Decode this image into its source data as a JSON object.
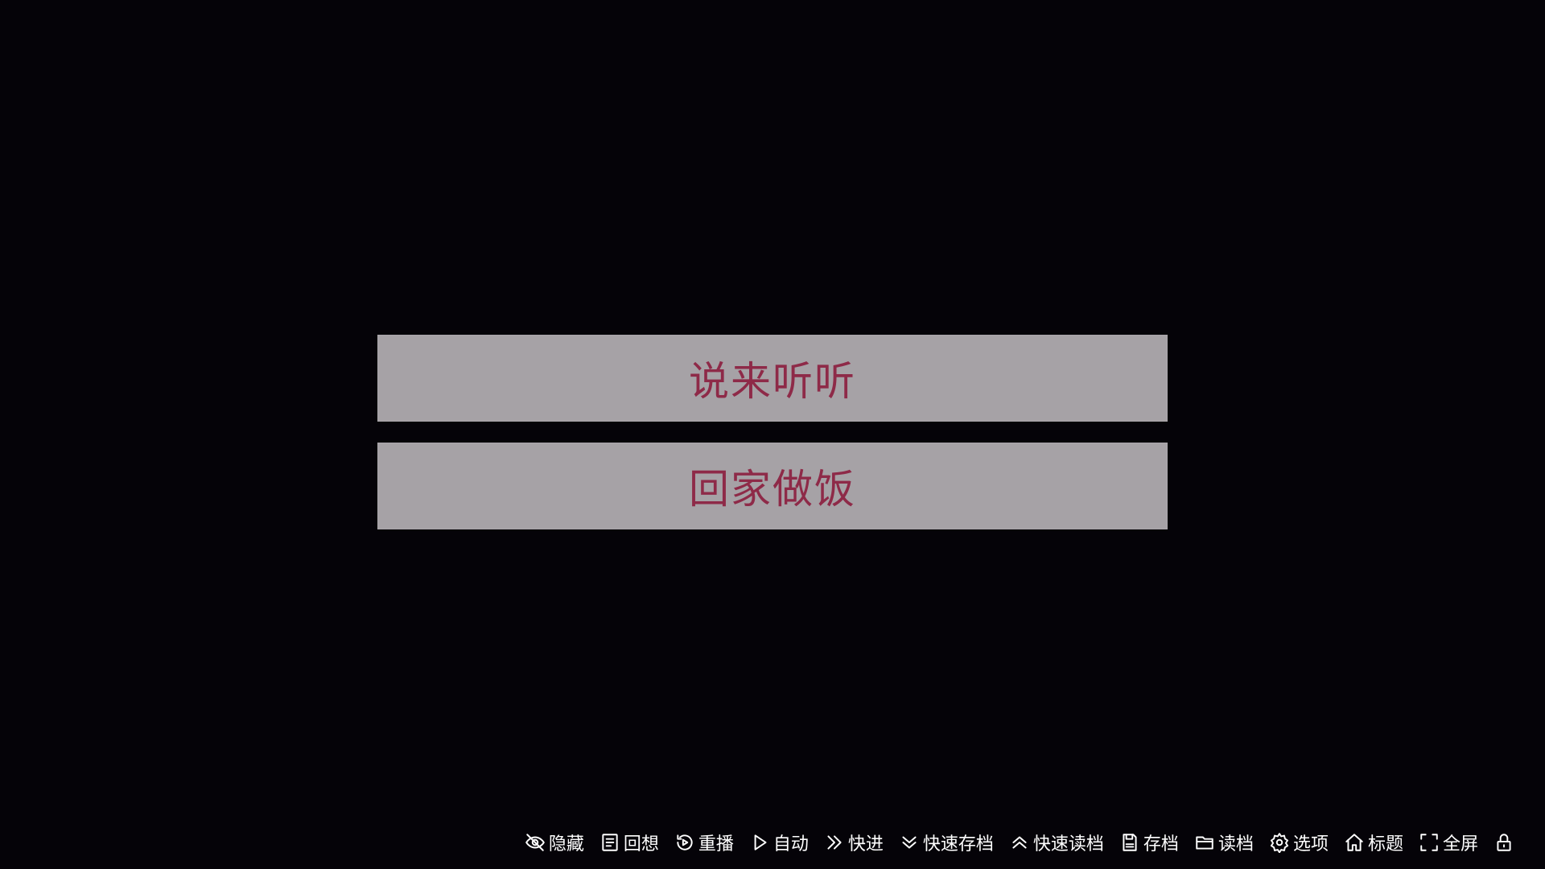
{
  "choices": [
    {
      "label": "说来听听"
    },
    {
      "label": "回家做饭"
    }
  ],
  "quick_menu": {
    "hide": {
      "label": "隐藏",
      "icon": "eye-off-icon"
    },
    "history": {
      "label": "回想",
      "icon": "document-list-icon"
    },
    "replay": {
      "label": "重播",
      "icon": "replay-icon"
    },
    "auto": {
      "label": "自动",
      "icon": "play-icon"
    },
    "skip": {
      "label": "快进",
      "icon": "fast-forward-icon"
    },
    "quick_save": {
      "label": "快速存档",
      "icon": "chevron-down-icon"
    },
    "quick_load": {
      "label": "快速读档",
      "icon": "chevron-up-icon"
    },
    "save": {
      "label": "存档",
      "icon": "save-file-icon"
    },
    "load": {
      "label": "读档",
      "icon": "folder-icon"
    },
    "options": {
      "label": "选项",
      "icon": "gear-icon"
    },
    "title": {
      "label": "标题",
      "icon": "home-icon"
    },
    "fullscreen": {
      "label": "全屏",
      "icon": "fullscreen-icon"
    },
    "lock": {
      "icon": "lock-icon"
    }
  },
  "colors": {
    "background": "#050308",
    "choice_bg": "#a6a2a6",
    "choice_text": "#8e2a48",
    "menu_text": "#ffffff"
  }
}
